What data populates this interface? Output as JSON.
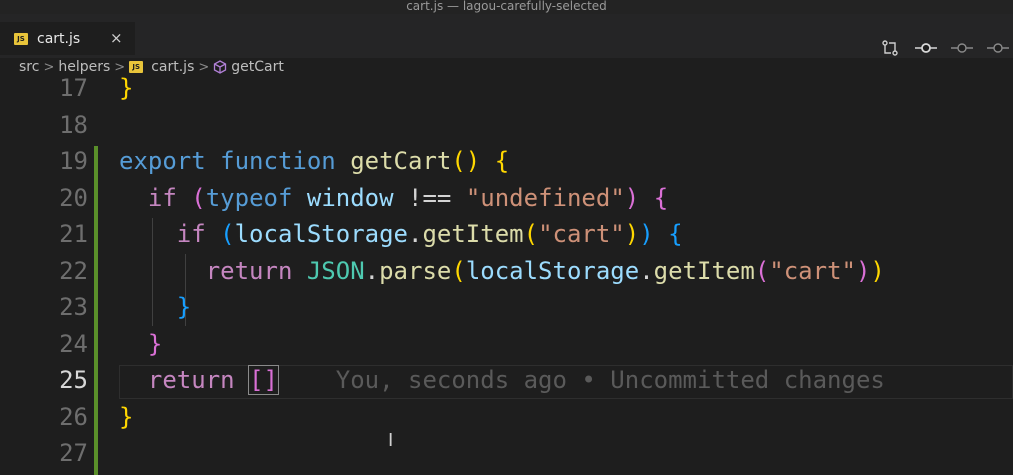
{
  "window": {
    "title": "cart.js — lagou-carefully-selected"
  },
  "tab": {
    "label": "cart.js",
    "close": "×",
    "badge": "JS"
  },
  "breadcrumb": {
    "items": [
      "src",
      "helpers",
      "cart.js",
      "getCart"
    ],
    "separator": ">"
  },
  "toolbar": {
    "icons": [
      "git-compare-icon",
      "git-commit-icon",
      "git-previous-icon",
      "git-next-icon"
    ]
  },
  "editor": {
    "lines": [
      {
        "number": "17",
        "tokens": [
          [
            "b1",
            "}"
          ]
        ]
      },
      {
        "number": "18",
        "tokens": []
      },
      {
        "number": "19",
        "tokens": [
          [
            "kw-blue",
            "export"
          ],
          [
            "plain",
            " "
          ],
          [
            "kw-blue",
            "function"
          ],
          [
            "plain",
            " "
          ],
          [
            "fn",
            "getCart"
          ],
          [
            "b1",
            "()"
          ],
          [
            "plain",
            " "
          ],
          [
            "b1",
            "{"
          ]
        ]
      },
      {
        "number": "20",
        "tokens": [
          [
            "plain",
            "  "
          ],
          [
            "kw-purple",
            "if"
          ],
          [
            "plain",
            " "
          ],
          [
            "b2",
            "("
          ],
          [
            "kw-blue",
            "typeof"
          ],
          [
            "plain",
            " "
          ],
          [
            "var",
            "window"
          ],
          [
            "plain",
            " !== "
          ],
          [
            "str",
            "\"undefined\""
          ],
          [
            "b2",
            ")"
          ],
          [
            "plain",
            " "
          ],
          [
            "b2",
            "{"
          ]
        ]
      },
      {
        "number": "21",
        "tokens": [
          [
            "plain",
            "    "
          ],
          [
            "kw-purple",
            "if"
          ],
          [
            "plain",
            " "
          ],
          [
            "b3",
            "("
          ],
          [
            "var",
            "localStorage"
          ],
          [
            "plain",
            "."
          ],
          [
            "fn",
            "getItem"
          ],
          [
            "b1",
            "("
          ],
          [
            "str",
            "\"cart\""
          ],
          [
            "b1",
            ")"
          ],
          [
            "b3",
            ")"
          ],
          [
            "plain",
            " "
          ],
          [
            "b3",
            "{"
          ]
        ]
      },
      {
        "number": "22",
        "tokens": [
          [
            "plain",
            "      "
          ],
          [
            "kw-purple",
            "return"
          ],
          [
            "plain",
            " "
          ],
          [
            "cls",
            "JSON"
          ],
          [
            "plain",
            "."
          ],
          [
            "fn",
            "parse"
          ],
          [
            "b1",
            "("
          ],
          [
            "var",
            "localStorage"
          ],
          [
            "plain",
            "."
          ],
          [
            "fn",
            "getItem"
          ],
          [
            "b2",
            "("
          ],
          [
            "str",
            "\"cart\""
          ],
          [
            "b2",
            ")"
          ],
          [
            "b1",
            ")"
          ]
        ]
      },
      {
        "number": "23",
        "tokens": [
          [
            "plain",
            "    "
          ],
          [
            "b3",
            "}"
          ]
        ]
      },
      {
        "number": "24",
        "tokens": [
          [
            "plain",
            "  "
          ],
          [
            "b2",
            "}"
          ]
        ]
      },
      {
        "number": "25",
        "tokens": [
          [
            "plain",
            "  "
          ],
          [
            "kw-purple",
            "return"
          ],
          [
            "plain",
            " "
          ],
          [
            "b2 cursor-box",
            "[]"
          ]
        ],
        "blame": "You, seconds ago • Uncommitted changes"
      },
      {
        "number": "26",
        "tokens": [
          [
            "b1",
            "}"
          ]
        ]
      },
      {
        "number": "27",
        "tokens": []
      }
    ],
    "active_line": "25"
  },
  "colors": {
    "background": "#1e1e1e",
    "git_added_bar": "#5a8f2a",
    "js_badge": "#e8c43a"
  }
}
